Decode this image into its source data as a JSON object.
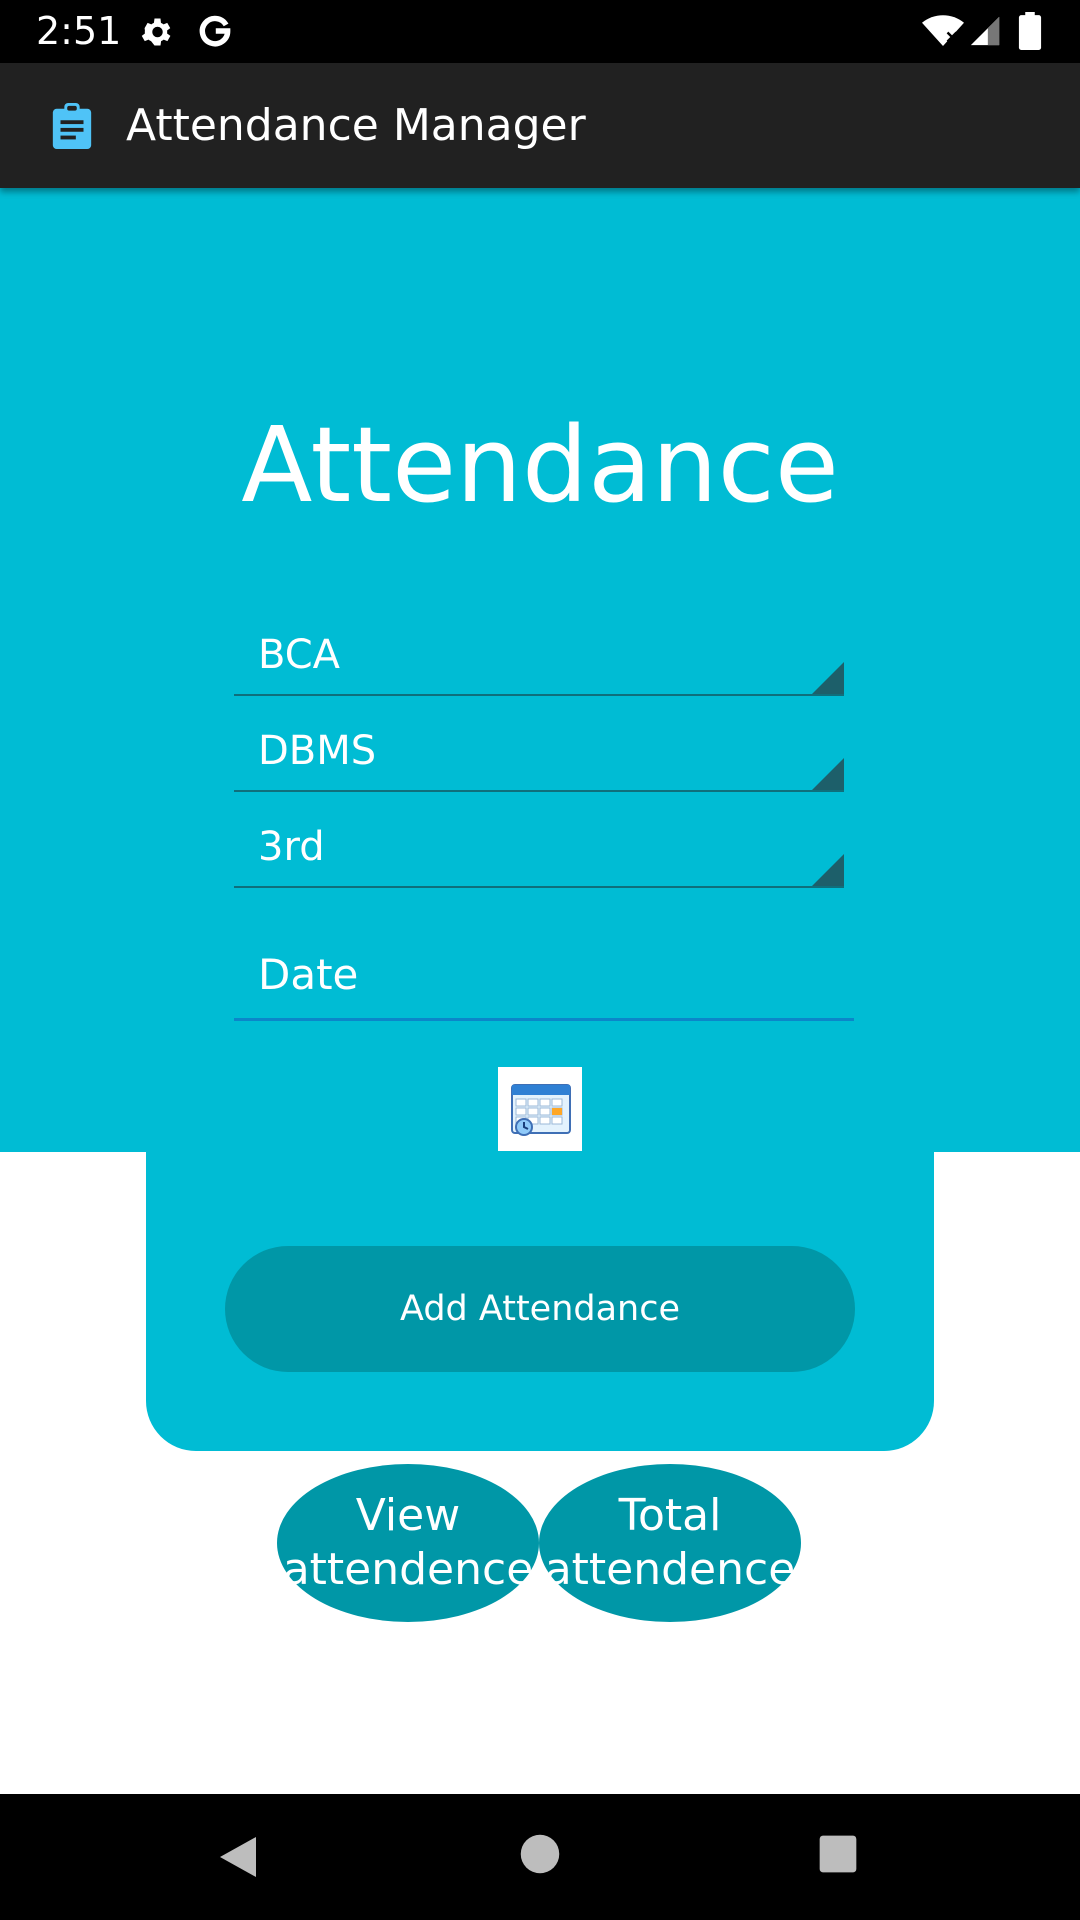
{
  "status_bar": {
    "time": "2:51",
    "icons": [
      "settings-icon",
      "google-icon",
      "wifi-icon",
      "signal-icon",
      "battery-icon"
    ]
  },
  "app_bar": {
    "title": "Attendance Manager",
    "icon": "clipboard-icon",
    "icon_color": "#4fc3f7",
    "background": "#212121"
  },
  "form": {
    "heading": "Attendance",
    "course_value": "BCA",
    "subject_value": "DBMS",
    "semester_value": "3rd",
    "date_placeholder": "Date",
    "calendar_icon": "calendar-icon",
    "add_button_label": "Add Attendance"
  },
  "actions": {
    "view_label_line1": "View",
    "view_label_line2": "attendence",
    "total_label_line1": "Total",
    "total_label_line2": "attendence"
  },
  "colors": {
    "primary": "#00bcd4",
    "button": "#0097a7",
    "date_underline": "#0b86c9"
  },
  "nav_bar": {
    "icons": [
      "back-icon",
      "home-icon",
      "recents-icon"
    ]
  }
}
